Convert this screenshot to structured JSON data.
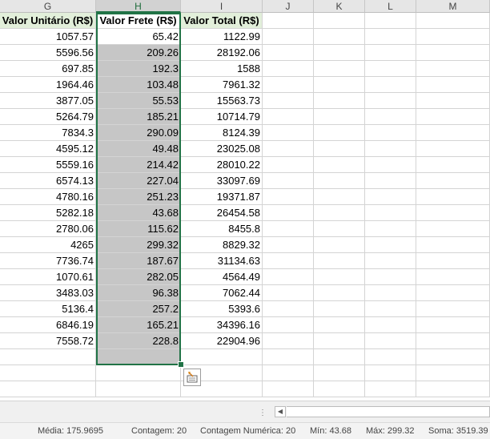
{
  "columns": [
    {
      "letter": "G",
      "selected": false
    },
    {
      "letter": "H",
      "selected": true
    },
    {
      "letter": "I",
      "selected": false
    },
    {
      "letter": "J",
      "selected": false
    },
    {
      "letter": "K",
      "selected": false
    },
    {
      "letter": "L",
      "selected": false
    },
    {
      "letter": "M",
      "selected": false
    }
  ],
  "headers": {
    "valor_unitario": "Valor Unitário (R$)",
    "valor_frete": "Valor Frete (R$)",
    "valor_total": "Valor Total (R$)"
  },
  "rows": [
    {
      "unitario": "1057.57",
      "frete": "65.42",
      "total": "1122.99"
    },
    {
      "unitario": "5596.56",
      "frete": "209.26",
      "total": "28192.06"
    },
    {
      "unitario": "697.85",
      "frete": "192.3",
      "total": "1588"
    },
    {
      "unitario": "1964.46",
      "frete": "103.48",
      "total": "7961.32"
    },
    {
      "unitario": "3877.05",
      "frete": "55.53",
      "total": "15563.73"
    },
    {
      "unitario": "5264.79",
      "frete": "185.21",
      "total": "10714.79"
    },
    {
      "unitario": "7834.3",
      "frete": "290.09",
      "total": "8124.39"
    },
    {
      "unitario": "4595.12",
      "frete": "49.48",
      "total": "23025.08"
    },
    {
      "unitario": "5559.16",
      "frete": "214.42",
      "total": "28010.22"
    },
    {
      "unitario": "6574.13",
      "frete": "227.04",
      "total": "33097.69"
    },
    {
      "unitario": "4780.16",
      "frete": "251.23",
      "total": "19371.87"
    },
    {
      "unitario": "5282.18",
      "frete": "43.68",
      "total": "26454.58"
    },
    {
      "unitario": "2780.06",
      "frete": "115.62",
      "total": "8455.8"
    },
    {
      "unitario": "4265",
      "frete": "299.32",
      "total": "8829.32"
    },
    {
      "unitario": "7736.74",
      "frete": "187.67",
      "total": "31134.63"
    },
    {
      "unitario": "1070.61",
      "frete": "282.05",
      "total": "4564.49"
    },
    {
      "unitario": "3483.03",
      "frete": "96.38",
      "total": "7062.44"
    },
    {
      "unitario": "5136.4",
      "frete": "257.2",
      "total": "5393.6"
    },
    {
      "unitario": "6846.19",
      "frete": "165.21",
      "total": "34396.16"
    },
    {
      "unitario": "7558.72",
      "frete": "228.8",
      "total": "22904.96"
    }
  ],
  "icons": {
    "quick_analysis": "quick-analysis-icon",
    "scroll_left": "scroll-left-arrow-icon",
    "sheet_options": "ellipsis-icon"
  },
  "colors": {
    "selection_border": "#217346",
    "selection_fill": "#c6c6c6",
    "header_fill": "#e2efda"
  },
  "statusbar": {
    "media": "Média: 175.9695",
    "contagem": "Contagem: 20",
    "contagem_numerica": "Contagem Numérica: 20",
    "min": "Mín: 43.68",
    "max": "Máx: 299.32",
    "soma": "Soma: 3519.39"
  }
}
